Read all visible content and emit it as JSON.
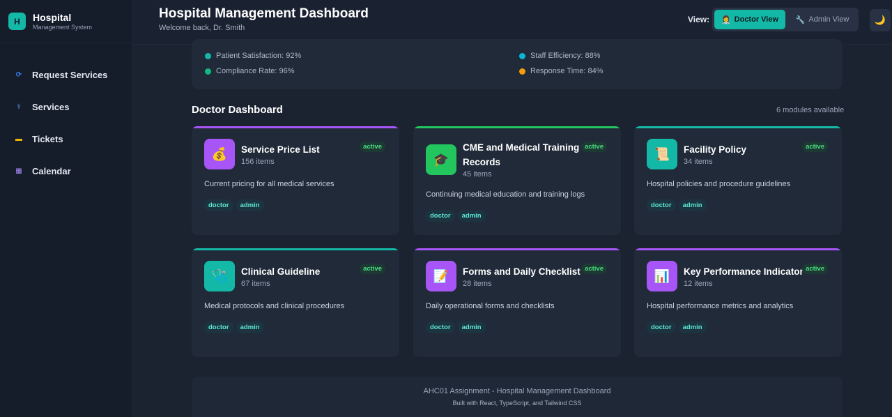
{
  "brand": {
    "logo": "H",
    "title": "Hospital",
    "subtitle": "Management System"
  },
  "nav": [
    {
      "label": "Request Services",
      "icon": "refresh-icon",
      "icon_glyph": "⟳",
      "color": "#3b82f6"
    },
    {
      "label": "Services",
      "icon": "caduceus-icon",
      "icon_glyph": "⚕",
      "color": "#60a5fa"
    },
    {
      "label": "Tickets",
      "icon": "ticket-icon",
      "icon_glyph": "▬",
      "color": "#eab308"
    },
    {
      "label": "Calendar",
      "icon": "calendar-icon",
      "icon_glyph": "▦",
      "color": "#a78bfa"
    }
  ],
  "header": {
    "title": "Hospital Management Dashboard",
    "subtitle": "Welcome back, Dr. Smith",
    "view_label": "View:",
    "doctor_view": "Doctor View",
    "admin_view": "Admin View",
    "doctor_icon": "👩‍⚕️",
    "admin_icon": "🔧",
    "theme_icon": "🌙"
  },
  "metrics": [
    {
      "label": "Patient Satisfaction: 92%",
      "color": "#14b8a6"
    },
    {
      "label": "Staff Efficiency: 88%",
      "color": "#06b6d4"
    },
    {
      "label": "Compliance Rate: 96%",
      "color": "#10b981"
    },
    {
      "label": "Response Time: 84%",
      "color": "#f59e0b"
    }
  ],
  "section": {
    "title": "Doctor Dashboard",
    "count": "6 modules available"
  },
  "cards": [
    {
      "title": "Service Price List",
      "count": "156 items",
      "status": "active",
      "desc": "Current pricing for all medical services",
      "tags": [
        "doctor",
        "admin"
      ],
      "icon": "money-bag-icon",
      "glyph": "💰",
      "accent": "#a855f7",
      "icon_bg": "#a855f7"
    },
    {
      "title": "CME and Medical Training Records",
      "count": "45 items",
      "status": "active",
      "desc": "Continuing medical education and training logs",
      "tags": [
        "doctor",
        "admin"
      ],
      "icon": "graduation-cap-icon",
      "glyph": "🎓",
      "accent": "#22c55e",
      "icon_bg": "#22c55e"
    },
    {
      "title": "Facility Policy",
      "count": "34 items",
      "status": "active",
      "desc": "Hospital policies and procedure guidelines",
      "tags": [
        "doctor",
        "admin"
      ],
      "icon": "scroll-icon",
      "glyph": "📜",
      "accent": "#14b8a6",
      "icon_bg": "#14b8a6"
    },
    {
      "title": "Clinical Guideline",
      "count": "67 items",
      "status": "active",
      "desc": "Medical protocols and clinical procedures",
      "tags": [
        "doctor",
        "admin"
      ],
      "icon": "stethoscope-icon",
      "glyph": "🩺",
      "accent": "#14b8a6",
      "icon_bg": "#14b8a6"
    },
    {
      "title": "Forms and Daily Checklist",
      "count": "28 items",
      "status": "active",
      "desc": "Daily operational forms and checklists",
      "tags": [
        "doctor",
        "admin"
      ],
      "icon": "clipboard-icon",
      "glyph": "📝",
      "accent": "#a855f7",
      "icon_bg": "#a855f7"
    },
    {
      "title": "Key Performance Indicator",
      "count": "12 items",
      "status": "active",
      "desc": "Hospital performance metrics and analytics",
      "tags": [
        "doctor",
        "admin"
      ],
      "icon": "bar-chart-icon",
      "glyph": "📊",
      "accent": "#a855f7",
      "icon_bg": "#a855f7"
    }
  ],
  "footer": {
    "main": "AHC01 Assignment - Hospital Management Dashboard",
    "sub": "Built with React, TypeScript, and Tailwind CSS"
  }
}
